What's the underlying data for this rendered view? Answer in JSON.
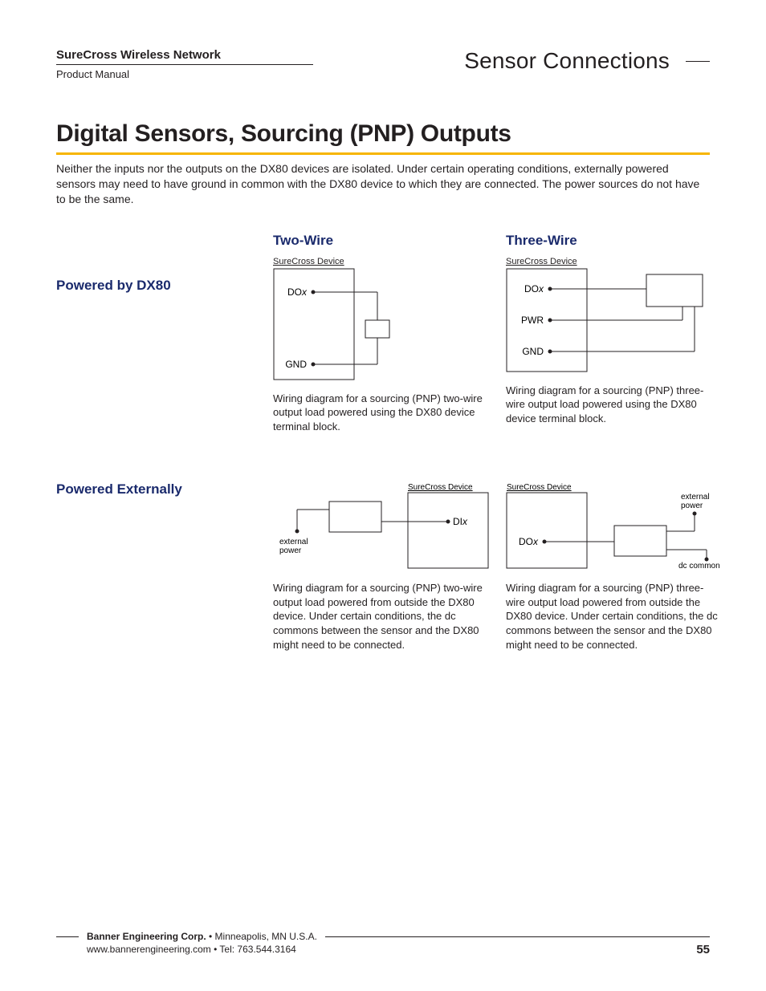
{
  "header": {
    "doc_title": "SureCross Wireless Network",
    "doc_sub": "Product Manual",
    "section": "Sensor Connections"
  },
  "main_heading": "Digital Sensors, Sourcing (PNP) Outputs",
  "intro": "Neither the inputs nor the outputs on the DX80 devices are isolated. Under certain operating conditions, externally powered sensors may need to have ground in common with the DX80 device to which they are connected. The power sources do not have to be the same.",
  "cols": {
    "two": "Two-Wire",
    "three": "Three-Wire"
  },
  "rows": {
    "dx80": "Powered by DX80",
    "external": "Powered Externally"
  },
  "device_label": "SureCross Device",
  "pins": {
    "dox": "DO",
    "dox_suffix": "x",
    "dix": "DI",
    "dix_suffix": "x",
    "pwr": "PWR",
    "gnd": "GND"
  },
  "ext_labels": {
    "external_power": "external\npower",
    "dc_common": "dc common"
  },
  "captions": {
    "r1c1": "Wiring diagram for a sourcing (PNP) two-wire output load powered using the DX80 device terminal block.",
    "r1c2": "Wiring diagram for a sourcing (PNP) three-wire output load powered using the DX80 device terminal block.",
    "r2c1": "Wiring diagram for a sourcing (PNP) two-wire output load powered from outside the DX80 device. Under certain conditions, the dc commons between the sensor and the DX80 might need to be connected.",
    "r2c2": "Wiring diagram for a sourcing (PNP) three-wire output load powered from outside the DX80 device. Under certain conditions, the dc commons between the sensor and the DX80 might need to be connected."
  },
  "footer": {
    "corp": "Banner Engineering Corp.",
    "loc": " •  Minneapolis, MN U.S.A.",
    "contact": "www.bannerengineering.com  •  Tel: 763.544.3164",
    "page": "55"
  }
}
